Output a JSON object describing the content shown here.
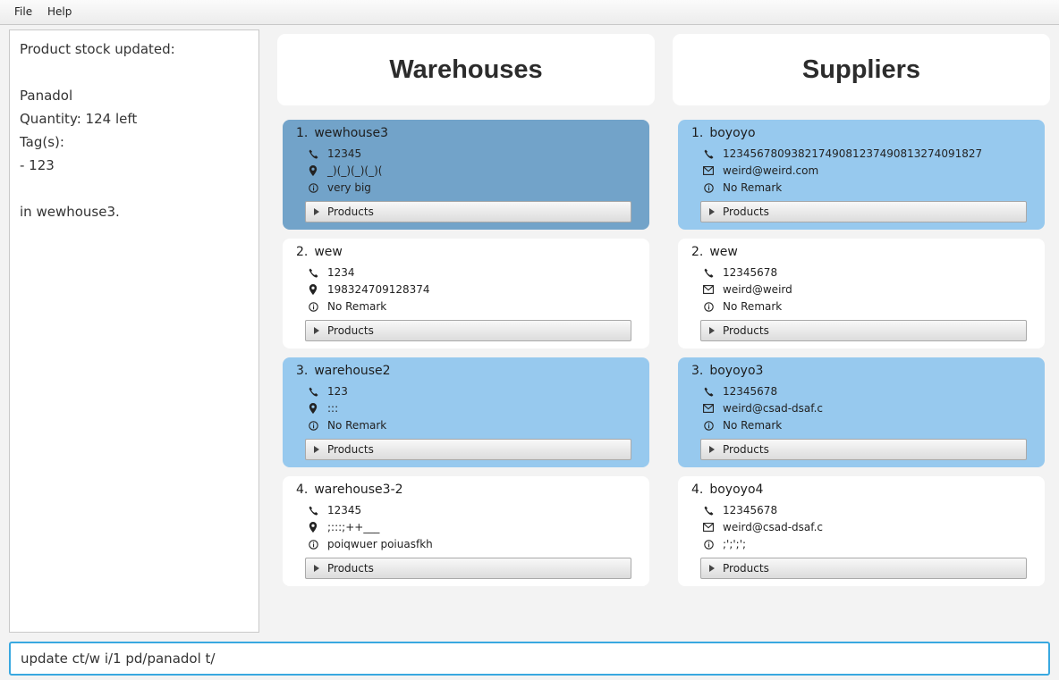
{
  "menu": {
    "file": "File",
    "help": "Help"
  },
  "result": {
    "text": "Product stock updated:\n\nPanadol\nQuantity: 124 left\nTag(s):\n- 123\n\nin wewhouse3."
  },
  "warehouses": {
    "header": "Warehouses",
    "cards": [
      {
        "index": "1.",
        "name": "wewhouse3",
        "phone": "12345",
        "address": "_)(_)(_)(_)(",
        "remark": "very big",
        "products_label": "Products"
      },
      {
        "index": "2.",
        "name": "wew",
        "phone": "1234",
        "address": "198324709128374",
        "remark": "No Remark",
        "products_label": "Products"
      },
      {
        "index": "3.",
        "name": "warehouse2",
        "phone": "123",
        "address": ":::",
        "remark": "No Remark",
        "products_label": "Products"
      },
      {
        "index": "4.",
        "name": "warehouse3-2",
        "phone": "12345",
        "address": ";:::;++___",
        "remark": "poiqwuer poiuasfkh",
        "products_label": "Products"
      }
    ]
  },
  "suppliers": {
    "header": "Suppliers",
    "cards": [
      {
        "index": "1.",
        "name": "boyoyo",
        "phone": "123456780938217490812374908132740918​27",
        "email": "weird@weird.com",
        "remark": "No Remark",
        "products_label": "Products"
      },
      {
        "index": "2.",
        "name": "wew",
        "phone": "12345678",
        "email": "weird@weird",
        "remark": "No Remark",
        "products_label": "Products"
      },
      {
        "index": "3.",
        "name": "boyoyo3",
        "phone": "12345678",
        "email": "weird@csad-dsaf.c",
        "remark": "No Remark",
        "products_label": "Products"
      },
      {
        "index": "4.",
        "name": "boyoyo4",
        "phone": "12345678",
        "email": "weird@csad-dsaf.c",
        "remark": ";';';';",
        "products_label": "Products"
      }
    ]
  },
  "command": {
    "value": "update ct/w i/1 pd/panadol t/"
  },
  "icons": {
    "phone": "phone-icon",
    "address": "location-pin-icon",
    "email": "envelope-icon",
    "remark": "info-icon"
  },
  "colors": {
    "selected_card": "#72a3c9",
    "highlight_card": "#97c9ee",
    "command_border": "#39a8e0"
  }
}
